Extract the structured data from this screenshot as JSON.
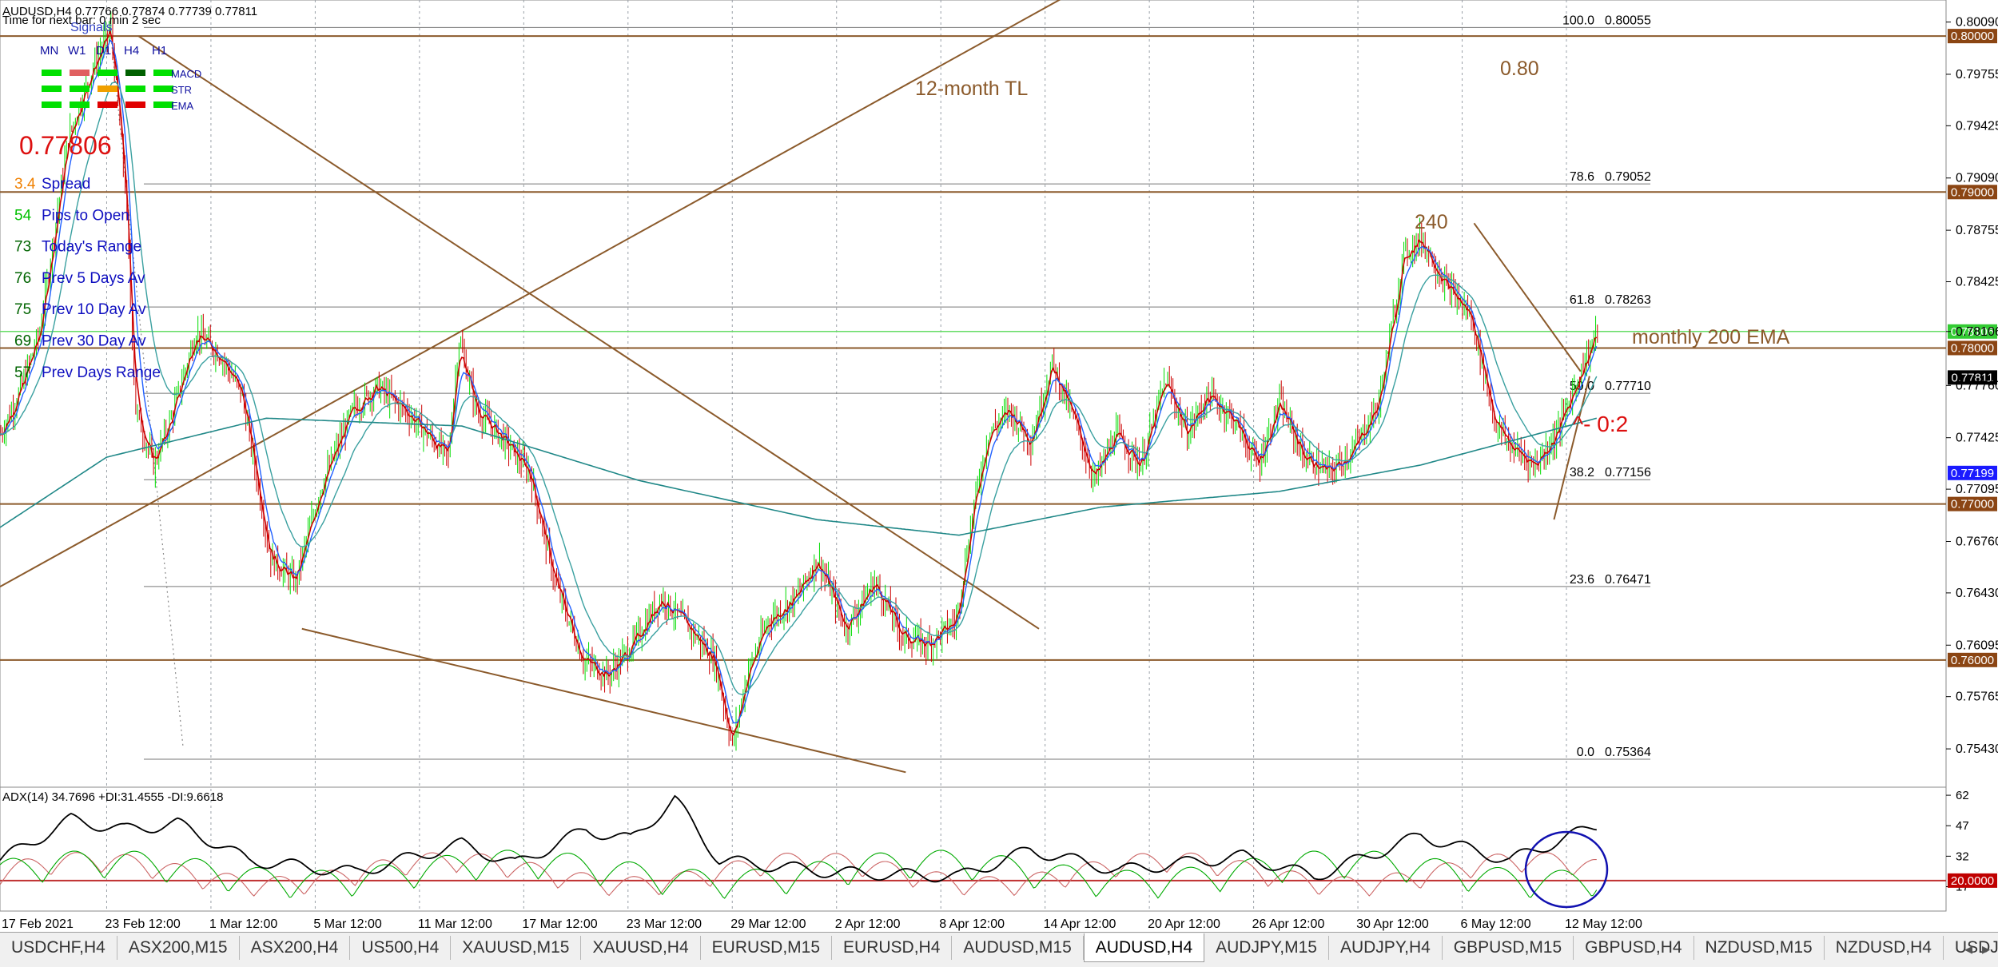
{
  "header": {
    "symbol_line": "AUDUSD,H4  0.77766 0.77874 0.77739 0.77811",
    "timer_line": "Time for next bar: 0 min 2 sec",
    "signals_title": "Signals",
    "timeframes": [
      "MN",
      "W1",
      "D1",
      "H4",
      "H1"
    ],
    "signal_rows": [
      "MACD",
      "STR",
      "EMA"
    ],
    "signal_colors": [
      [
        "#00e000",
        "#e06060",
        "#00e000",
        "#006000",
        "#00e000"
      ],
      [
        "#00e000",
        "#00e000",
        "#f0a000",
        "#00e000",
        "#00e000"
      ],
      [
        "#00e000",
        "#00e000",
        "#e00000",
        "#e00000",
        "#00e000"
      ]
    ]
  },
  "bid_price": "0.77806",
  "stats": [
    {
      "value": "3.4",
      "label": "Spread",
      "color": "#f08000"
    },
    {
      "value": "54",
      "label": "Pips to Open",
      "color": "#00c000"
    },
    {
      "value": "73",
      "label": "Today's Range",
      "color": "#006400"
    },
    {
      "value": "76",
      "label": "Prev 5 Days Av",
      "color": "#006400"
    },
    {
      "value": "75",
      "label": "Prev 10 Day Av",
      "color": "#006400"
    },
    {
      "value": "69",
      "label": "Prev 30 Day Av",
      "color": "#006400"
    },
    {
      "value": "57",
      "label": "Prev Days Range",
      "color": "#006400"
    }
  ],
  "annotations": {
    "tl_label": "12-month TL",
    "level_label": "0.80",
    "peak_label": "240",
    "ema_label": "monthly 200 EMA",
    "ratio_label": "^- 0:2"
  },
  "fibonacci": [
    {
      "ratio": "100.0",
      "price": "0.80055",
      "value": 0.80055
    },
    {
      "ratio": "78.6",
      "price": "0.79052",
      "value": 0.79052
    },
    {
      "ratio": "61.8",
      "price": "0.78263",
      "value": 0.78263
    },
    {
      "ratio": "50.0",
      "price": "0.77710",
      "value": 0.7771
    },
    {
      "ratio": "38.2",
      "price": "0.77156",
      "value": 0.77156
    },
    {
      "ratio": "23.6",
      "price": "0.76471",
      "value": 0.76471
    },
    {
      "ratio": "0.0",
      "price": "0.75364",
      "value": 0.75364
    }
  ],
  "horizontal_levels": [
    {
      "price": "0.80000",
      "value": 0.8
    },
    {
      "price": "0.79000",
      "value": 0.79
    },
    {
      "price": "0.78000",
      "value": 0.78
    },
    {
      "price": "0.77000",
      "value": 0.77
    },
    {
      "price": "0.76000",
      "value": 0.76
    }
  ],
  "ema_level": {
    "price": "0.78106",
    "value": 0.78106
  },
  "current_price": {
    "price": "0.77811",
    "value": 0.77811
  },
  "blue_tag": {
    "price": "0.77199",
    "value": 0.77199
  },
  "adx": {
    "label": "ADX(14) 34.7696 +DI:31.4555 -DI:9.6618",
    "axis_ticks": [
      "62",
      "47",
      "32",
      "17"
    ],
    "level": {
      "price": "20.0000",
      "value": 20
    }
  },
  "colors": {
    "up": "#00dd00",
    "down": "#cc0000",
    "ma_fast": "#cc0000",
    "ma_mid": "#2060ff",
    "ma_slow": "#3aa0a0",
    "ma_200": "#208888",
    "trendline": "#8b5a2b",
    "adx": "#000000",
    "plus_di": "#00aa00",
    "minus_di": "#cc6666"
  },
  "chart_data": {
    "type": "candlestick",
    "symbol": "AUDUSD",
    "timeframe": "H4",
    "ylim": [
      0.7521,
      0.8018
    ],
    "y_ticks": [
      "0.80090",
      "0.79755",
      "0.79425",
      "0.79090",
      "0.78755",
      "0.78425",
      "0.78106",
      "0.77760",
      "0.77425",
      "0.77095",
      "0.76760",
      "0.76430",
      "0.76095",
      "0.75765",
      "0.75430"
    ],
    "x_ticks": [
      "17 Feb 2021",
      "23 Feb 12:00",
      "1 Mar 12:00",
      "5 Mar 12:00",
      "11 Mar 12:00",
      "17 Mar 12:00",
      "23 Mar 12:00",
      "29 Mar 12:00",
      "2 Apr 12:00",
      "8 Apr 12:00",
      "14 Apr 12:00",
      "20 Apr 12:00",
      "26 Apr 12:00",
      "30 Apr 12:00",
      "6 May 12:00",
      "12 May 12:00"
    ],
    "close_path": [
      [
        0,
        0.7745
      ],
      [
        10,
        0.777
      ],
      [
        22,
        0.781
      ],
      [
        38,
        0.7935
      ],
      [
        52,
        0.798
      ],
      [
        62,
        0.8005
      ],
      [
        70,
        0.7905
      ],
      [
        76,
        0.776
      ],
      [
        86,
        0.7725
      ],
      [
        96,
        0.7755
      ],
      [
        110,
        0.781
      ],
      [
        124,
        0.7795
      ],
      [
        136,
        0.777
      ],
      [
        152,
        0.7665
      ],
      [
        166,
        0.765
      ],
      [
        180,
        0.771
      ],
      [
        198,
        0.776
      ],
      [
        212,
        0.7775
      ],
      [
        228,
        0.776
      ],
      [
        240,
        0.7745
      ],
      [
        252,
        0.773
      ],
      [
        258,
        0.7805
      ],
      [
        268,
        0.776
      ],
      [
        284,
        0.774
      ],
      [
        298,
        0.772
      ],
      [
        312,
        0.765
      ],
      [
        328,
        0.76
      ],
      [
        342,
        0.759
      ],
      [
        356,
        0.761
      ],
      [
        372,
        0.764
      ],
      [
        388,
        0.762
      ],
      [
        402,
        0.76
      ],
      [
        412,
        0.7545
      ],
      [
        420,
        0.759
      ],
      [
        432,
        0.7625
      ],
      [
        448,
        0.764
      ],
      [
        460,
        0.7665
      ],
      [
        476,
        0.762
      ],
      [
        492,
        0.765
      ],
      [
        508,
        0.7615
      ],
      [
        522,
        0.761
      ],
      [
        538,
        0.7625
      ],
      [
        548,
        0.77
      ],
      [
        556,
        0.7745
      ],
      [
        568,
        0.776
      ],
      [
        580,
        0.774
      ],
      [
        592,
        0.779
      ],
      [
        604,
        0.7755
      ],
      [
        616,
        0.7715
      ],
      [
        628,
        0.7745
      ],
      [
        642,
        0.7725
      ],
      [
        656,
        0.778
      ],
      [
        668,
        0.7745
      ],
      [
        680,
        0.777
      ],
      [
        694,
        0.7755
      ],
      [
        708,
        0.7725
      ],
      [
        720,
        0.7765
      ],
      [
        734,
        0.773
      ],
      [
        748,
        0.772
      ],
      [
        762,
        0.7735
      ],
      [
        776,
        0.7765
      ],
      [
        790,
        0.786
      ],
      [
        800,
        0.787
      ],
      [
        814,
        0.784
      ],
      [
        828,
        0.782
      ],
      [
        842,
        0.775
      ],
      [
        852,
        0.7735
      ],
      [
        864,
        0.7725
      ],
      [
        876,
        0.7745
      ],
      [
        888,
        0.778
      ],
      [
        899,
        0.7811
      ]
    ],
    "ema_200_path": [
      [
        0,
        0.7685
      ],
      [
        60,
        0.773
      ],
      [
        150,
        0.7755
      ],
      [
        260,
        0.775
      ],
      [
        360,
        0.7715
      ],
      [
        460,
        0.769
      ],
      [
        540,
        0.768
      ],
      [
        620,
        0.7698
      ],
      [
        720,
        0.7708
      ],
      [
        800,
        0.7725
      ],
      [
        899,
        0.7755
      ]
    ],
    "trendlines": [
      {
        "name": "12-month TL",
        "from": [
          0,
          0.7647
        ],
        "to": [
          620,
          0.8038
        ]
      },
      {
        "from": [
          78,
          0.8
        ],
        "to": [
          585,
          0.762
        ]
      },
      {
        "from": [
          170,
          0.762
        ],
        "to": [
          510,
          0.7528
        ]
      },
      {
        "from": [
          830,
          0.788
        ],
        "to": [
          890,
          0.7785
        ]
      },
      {
        "from": [
          875,
          0.769
        ],
        "to": [
          895,
          0.7782
        ]
      }
    ]
  }
}
